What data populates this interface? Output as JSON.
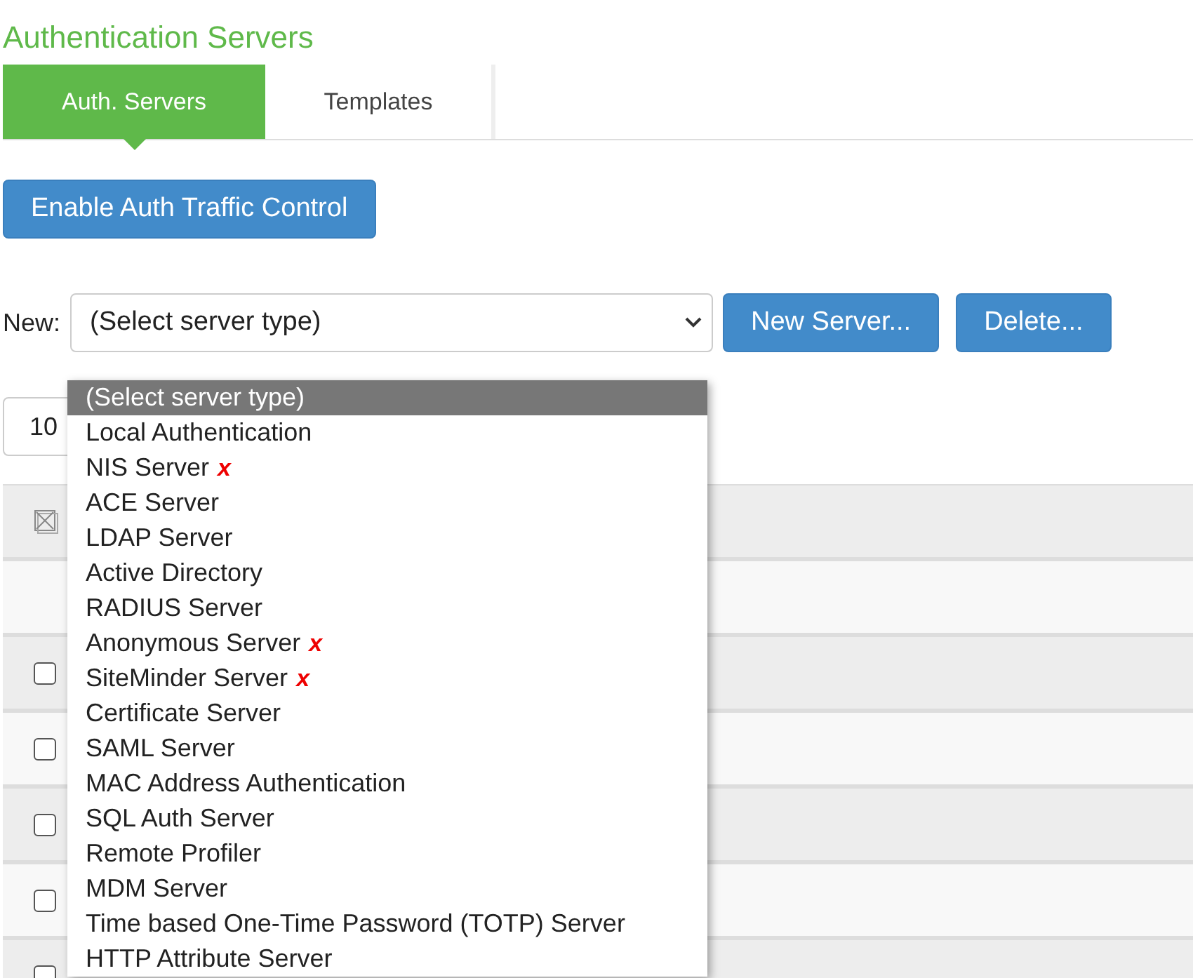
{
  "page_title": "Authentication Servers",
  "tabs": [
    {
      "label": "Auth. Servers",
      "selected": true
    },
    {
      "label": "Templates",
      "selected": false
    }
  ],
  "traffic_button": "Enable Auth Traffic Control",
  "new_row": {
    "label": "New:",
    "select_value": "(Select server type)",
    "buttons": [
      "New Server...",
      "Delete..."
    ]
  },
  "page_size": "10",
  "server_type_options": [
    {
      "label": "(Select server type)",
      "selected": true
    },
    {
      "label": "Local Authentication",
      "selected": false
    },
    {
      "label": "NIS Server",
      "selected": false,
      "marker": "x"
    },
    {
      "label": "ACE Server",
      "selected": false
    },
    {
      "label": "LDAP Server",
      "selected": false
    },
    {
      "label": "Active Directory",
      "selected": false
    },
    {
      "label": "RADIUS Server",
      "selected": false
    },
    {
      "label": "Anonymous Server",
      "selected": false,
      "marker": "x"
    },
    {
      "label": "SiteMinder Server",
      "selected": false,
      "marker": "x"
    },
    {
      "label": "Certificate Server",
      "selected": false
    },
    {
      "label": "SAML Server",
      "selected": false
    },
    {
      "label": "MAC Address Authentication",
      "selected": false
    },
    {
      "label": "SQL Auth Server",
      "selected": false
    },
    {
      "label": "Remote Profiler",
      "selected": false
    },
    {
      "label": "MDM Server",
      "selected": false
    },
    {
      "label": "Time based One-Time Password (TOTP) Server",
      "selected": false
    },
    {
      "label": "HTTP Attribute Server",
      "selected": false
    }
  ],
  "table": {
    "rows": [
      {
        "kind": "empty"
      },
      {
        "kind": "item",
        "checked": false
      },
      {
        "kind": "item",
        "checked": false
      },
      {
        "kind": "item",
        "checked": false
      },
      {
        "kind": "item",
        "checked": false
      },
      {
        "kind": "item",
        "checked": false
      }
    ]
  }
}
